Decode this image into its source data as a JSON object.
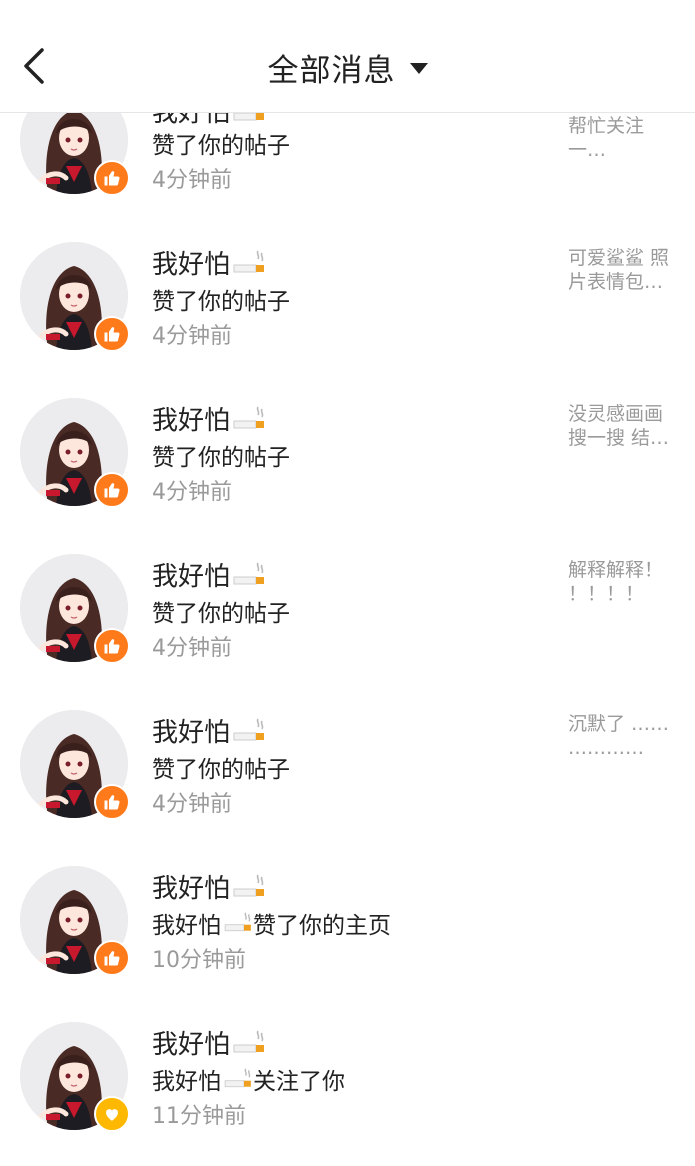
{
  "header": {
    "title": "全部消息"
  },
  "colors": {
    "like_badge": "#ff7a1a",
    "follow_badge": "#ffb800",
    "secondary_text": "#9a9a9a"
  },
  "icons": {
    "back": "chevron-left-icon",
    "dropdown": "caret-down-icon",
    "like": "thumbs-up-icon",
    "follow": "heart-icon",
    "name_emoji": "cigarette-icon"
  },
  "messages": [
    {
      "name": "我好怕",
      "action": "赞了你的帖子",
      "time": "4分钟前",
      "preview_line1": "帮忙关注",
      "preview_line2": "一…",
      "type": "like"
    },
    {
      "name": "我好怕",
      "action": "赞了你的帖子",
      "time": "4分钟前",
      "preview_line1": "可爱鲨鲨 照",
      "preview_line2": "片表情包…",
      "type": "like"
    },
    {
      "name": "我好怕",
      "action": "赞了你的帖子",
      "time": "4分钟前",
      "preview_line1": "没灵感画画",
      "preview_line2": "搜一搜 结…",
      "type": "like"
    },
    {
      "name": "我好怕",
      "action": "赞了你的帖子",
      "time": "4分钟前",
      "preview_line1": "解释解释！",
      "preview_line2": "！！！！",
      "type": "like"
    },
    {
      "name": "我好怕",
      "action": "赞了你的帖子",
      "time": "4分钟前",
      "preview_line1": "沉默了 ……",
      "preview_line2": "…………",
      "type": "like"
    },
    {
      "name": "我好怕",
      "action_prefix": "我好怕",
      "action": "赞了你的主页",
      "time": "10分钟前",
      "preview_line1": "",
      "preview_line2": "",
      "type": "like"
    },
    {
      "name": "我好怕",
      "action_prefix": "我好怕",
      "action": "关注了你",
      "time": "11分钟前",
      "preview_line1": "",
      "preview_line2": "",
      "type": "follow"
    }
  ]
}
